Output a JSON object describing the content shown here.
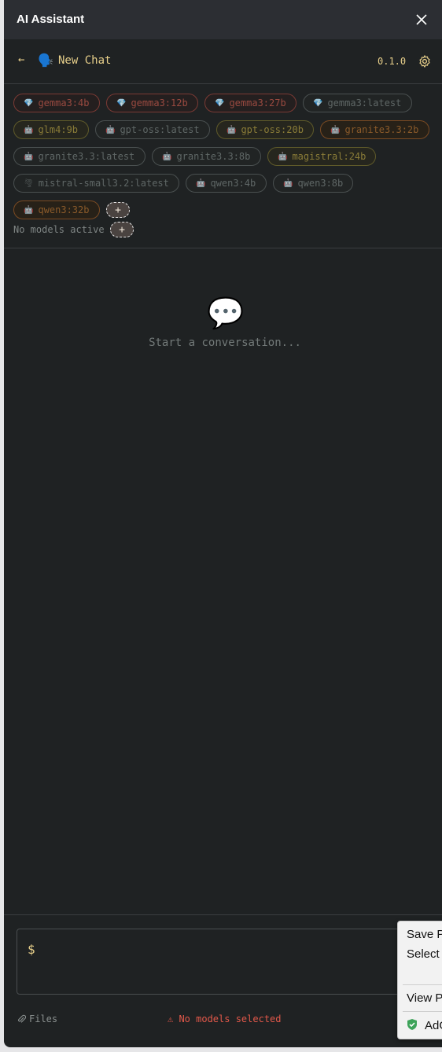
{
  "window": {
    "title": "AI Assistant"
  },
  "header": {
    "back": "←",
    "emoji": "🗣️",
    "chat_title": "New Chat",
    "version": "0.1.0"
  },
  "models": [
    {
      "label": "gemma3:4b",
      "icon": "💎",
      "state": "red"
    },
    {
      "label": "gemma3:12b",
      "icon": "💎",
      "state": "red"
    },
    {
      "label": "gemma3:27b",
      "icon": "💎",
      "state": "red"
    },
    {
      "label": "gemma3:latest",
      "icon": "💎",
      "state": "gray"
    },
    {
      "label": "glm4:9b",
      "icon": "🤖",
      "state": "yellow"
    },
    {
      "label": "gpt-oss:latest",
      "icon": "🤖",
      "state": "gray"
    },
    {
      "label": "gpt-oss:20b",
      "icon": "🤖",
      "state": "yellow"
    },
    {
      "label": "granite3.3:2b",
      "icon": "🤖",
      "state": "orange"
    },
    {
      "label": "granite3.3:latest",
      "icon": "🤖",
      "state": "gray"
    },
    {
      "label": "granite3.3:8b",
      "icon": "🤖",
      "state": "gray"
    },
    {
      "label": "magistral:24b",
      "icon": "🤖",
      "state": "yellow"
    },
    {
      "label": "mistral-small3.2:latest",
      "icon": "🌪",
      "state": "gray"
    },
    {
      "label": "qwen3:4b",
      "icon": "🤖",
      "state": "gray"
    },
    {
      "label": "qwen3:8b",
      "icon": "🤖",
      "state": "gray"
    },
    {
      "label": "qwen3:32b",
      "icon": "🤖",
      "state": "orange"
    }
  ],
  "add_label": "+",
  "status": {
    "no_models_active": "No models active"
  },
  "empty_state": {
    "icon": "💬",
    "text": "Start a conversation..."
  },
  "composer": {
    "prompt": "$",
    "files_label": "Files",
    "warning": "⚠ No models selected"
  },
  "context_menu": {
    "items": [
      "Save P",
      "Select",
      "View P",
      "AdG"
    ]
  },
  "colors": {
    "accent": "#e7cf8a",
    "warning": "#e2584a",
    "background": "#1f2223"
  }
}
